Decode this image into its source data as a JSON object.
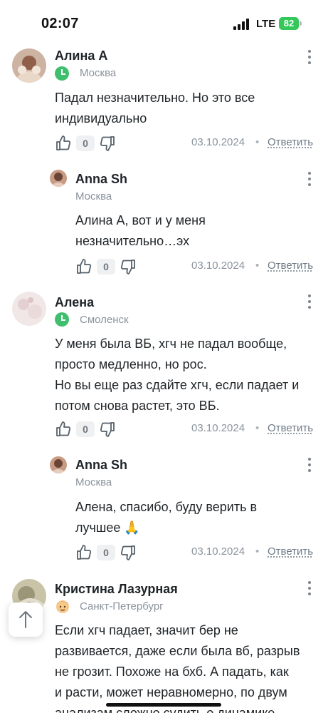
{
  "status_bar": {
    "time": "02:07",
    "network": "LTE",
    "battery": "82"
  },
  "comments": [
    {
      "author": "Алина А",
      "city": "Москва",
      "text": "Падал незначительно. Но это все\nиндивидуально",
      "likes": "0",
      "date": "03.10.2024",
      "reply_label": "Ответить",
      "avatar_color": "#b58a73"
    },
    {
      "author": "Anna Sh",
      "city": "Москва",
      "text": "Алина А, вот и у меня\nнезначительно…эх",
      "likes": "0",
      "date": "03.10.2024",
      "reply_label": "Ответить",
      "avatar_color": "#9a6e58"
    },
    {
      "author": "Алена",
      "city": "Смоленск",
      "text": "У меня была ВБ, хгч не падал вообще,\nпросто медленно, но рос.\nНо вы еще раз сдайте хгч, если падает и\nпотом снова растет, это ВБ.",
      "likes": "0",
      "date": "03.10.2024",
      "reply_label": "Ответить",
      "avatar_color": "#eadcdc"
    },
    {
      "author": "Anna Sh",
      "city": "Москва",
      "text": "Алена, спасибо, буду верить в\nлучшее 🙏",
      "likes": "0",
      "date": "03.10.2024",
      "reply_label": "Ответить",
      "avatar_color": "#9a6e58"
    },
    {
      "author": "Кристина Лазурная",
      "city": "Санкт-Петербург",
      "text": "Если хгч падает, значит бер не\nразвивается, даже если была вб, разрыв\nне грозит. Похоже на бхб. А падать, как\nи расти, может неравномерно, по двум\nанализам сложно судить о динамике.",
      "avatar_color": "#b9b49a"
    }
  ],
  "colors": {
    "accent_green": "#3fbf6e",
    "muted_text": "#8a939c",
    "primary_text": "#1f2428"
  }
}
